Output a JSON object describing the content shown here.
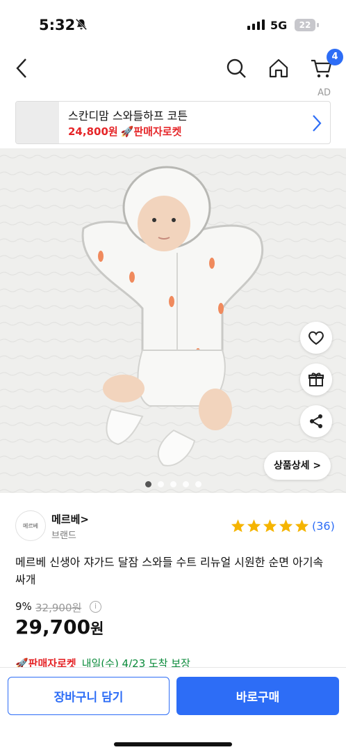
{
  "status_bar": {
    "time": "5:32",
    "network": "5G",
    "battery": "22"
  },
  "nav": {
    "cart_badge": "4",
    "ad_label": "AD"
  },
  "ad": {
    "title": "스칸디맘 스와들하프 코튼",
    "price": "24,800원",
    "rocket_label": "🚀판매자로켓"
  },
  "hero": {
    "detail_button": "상품상세 >",
    "page_count": 5,
    "active_page": 1
  },
  "brand": {
    "logo_text": "메르베",
    "name": "메르베>",
    "subtitle": "브랜드",
    "rating": 5,
    "review_count": "(36)"
  },
  "product": {
    "title": "메르베 신생아 쟈가드 달잠 스와들 수트 리뉴얼 시원한 순면 아기속싸개",
    "discount": "9%",
    "original_price": "32,900원",
    "price_number": "29,700",
    "price_unit": "원"
  },
  "delivery": {
    "rocket_label": "🚀판매자로켓",
    "eta": "내일(수) 4/23 도착 보장"
  },
  "actions": {
    "cart_button": "장바구니 담기",
    "buy_button": "바로구매"
  },
  "colors": {
    "accent": "#2d6df6",
    "rocket_red": "#e52528",
    "eta_green": "#0a8a3a",
    "star": "#f5b400"
  }
}
